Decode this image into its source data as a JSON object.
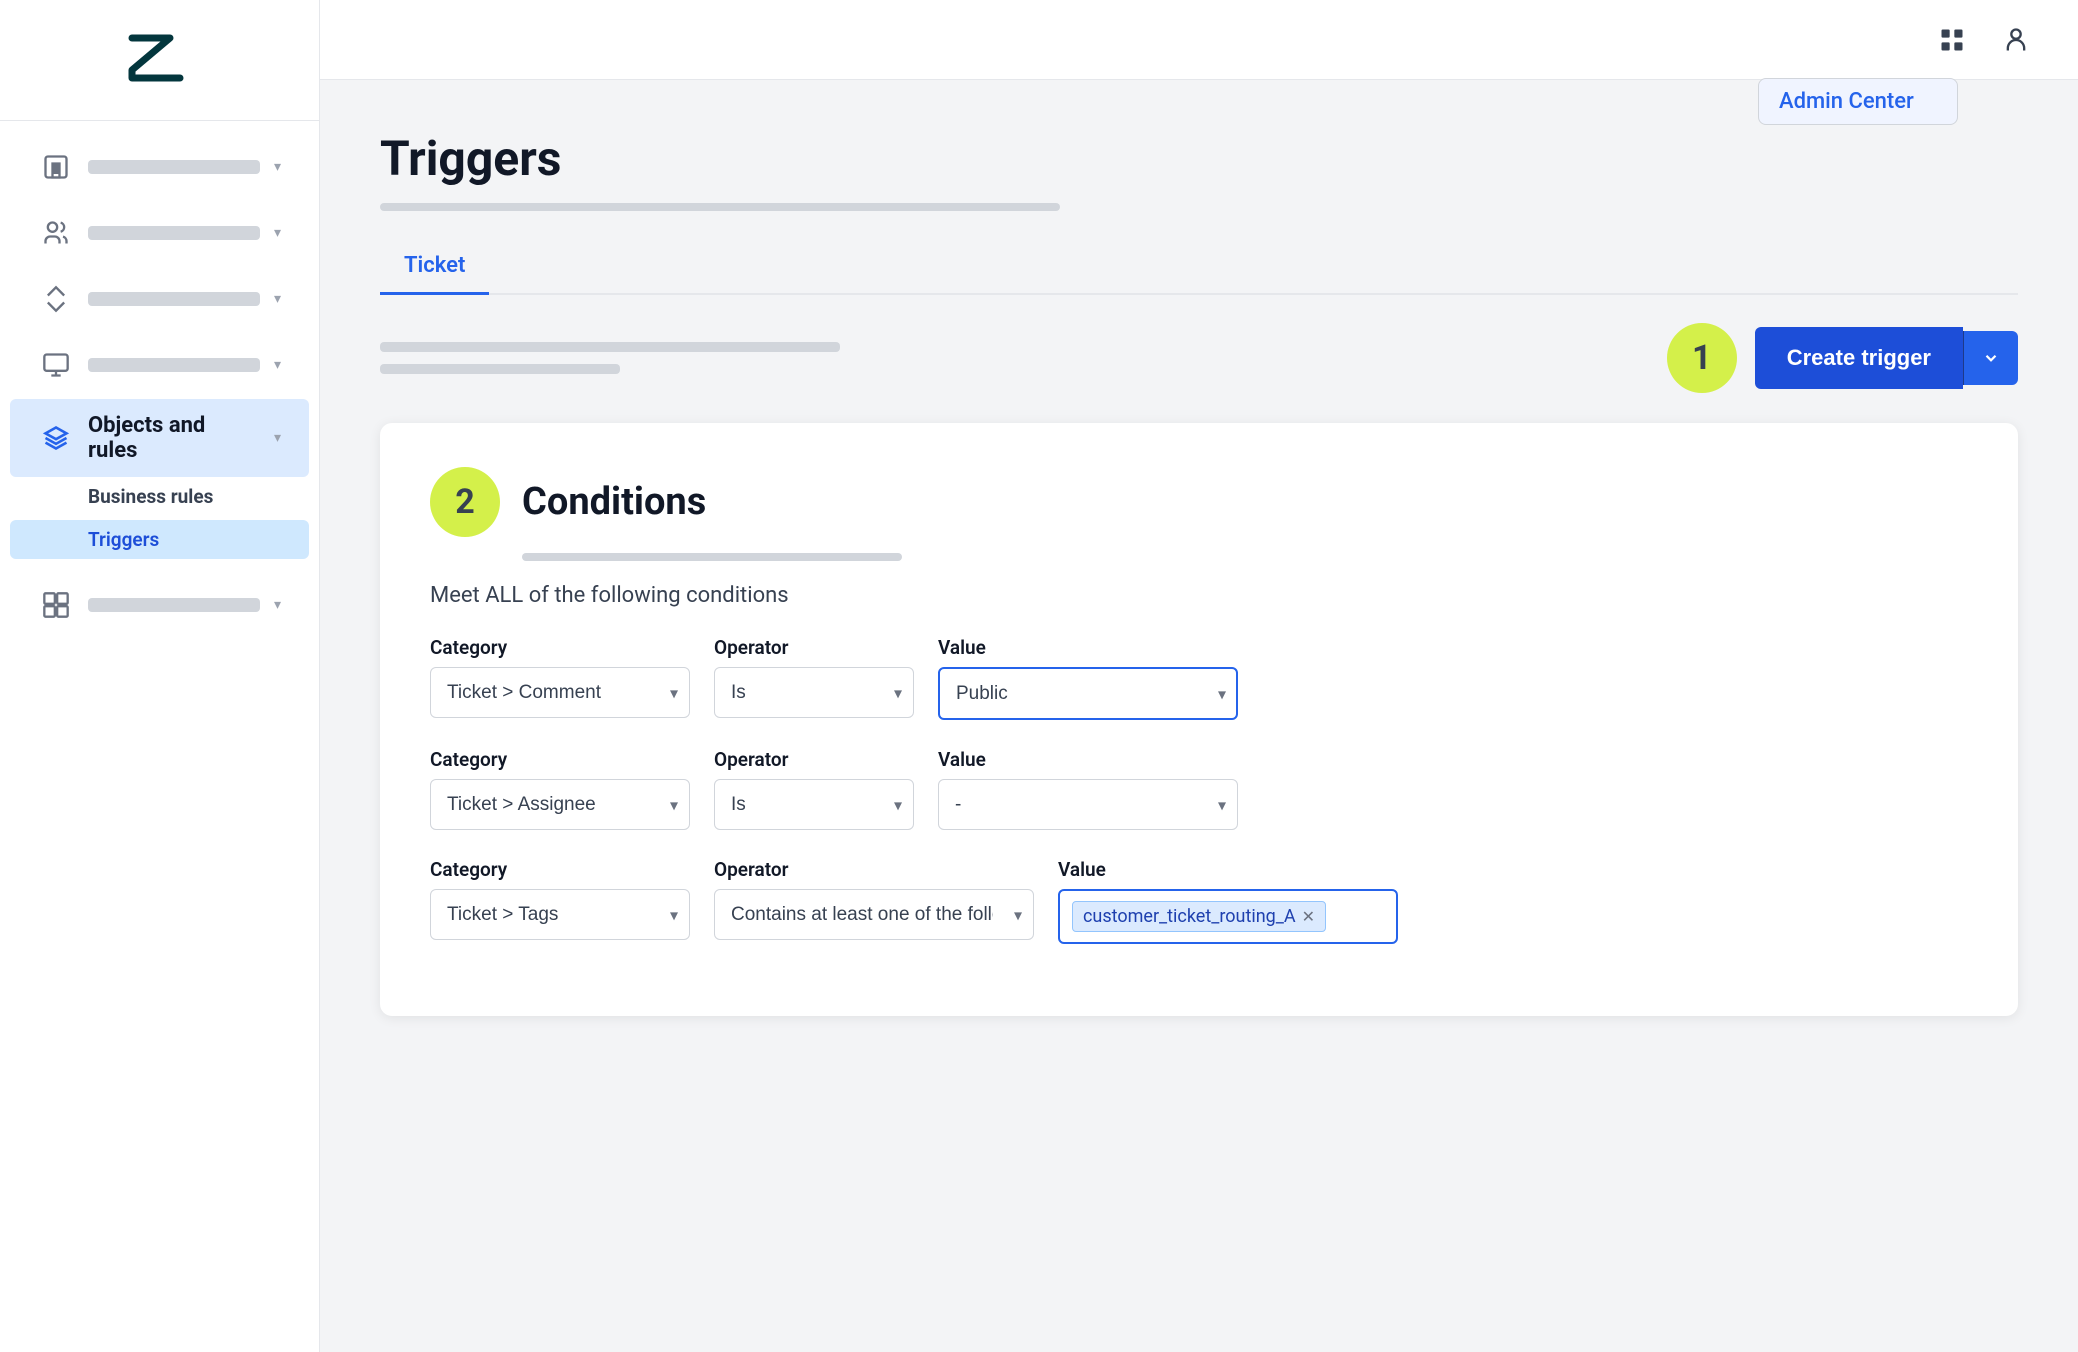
{
  "sidebar": {
    "nav_items": [
      {
        "id": "building",
        "icon": "building",
        "active": false
      },
      {
        "id": "people",
        "icon": "people",
        "active": false
      },
      {
        "id": "routing",
        "icon": "routing",
        "active": false
      },
      {
        "id": "workspaces",
        "icon": "workspaces",
        "active": false
      },
      {
        "id": "objects-and-rules",
        "icon": "objects-and-rules",
        "label": "Objects and rules",
        "active": true
      },
      {
        "id": "apps",
        "icon": "apps",
        "active": false
      }
    ],
    "sub_nav": {
      "group_label": "Business rules",
      "items": [
        {
          "id": "triggers",
          "label": "Triggers",
          "selected": true
        }
      ]
    }
  },
  "topbar": {
    "admin_center_label": "Admin Center"
  },
  "page": {
    "title": "Triggers",
    "tab_active": "Ticket",
    "tabs": [
      "Ticket"
    ],
    "create_trigger_label": "Create trigger"
  },
  "step1": {
    "badge": "1"
  },
  "step2": {
    "badge": "2"
  },
  "conditions": {
    "section_title": "Conditions",
    "meet_all_text": "Meet ALL of the following conditions",
    "rows": [
      {
        "category_label": "Category",
        "category_value": "Ticket > Comment",
        "operator_label": "Operator",
        "operator_value": "Is",
        "value_label": "Value",
        "value_value": "Public"
      },
      {
        "category_label": "Category",
        "category_value": "Ticket > Assignee",
        "operator_label": "Operator",
        "operator_value": "Is",
        "value_label": "Value",
        "value_value": "-"
      },
      {
        "category_label": "Category",
        "category_value": "Ticket > Tags",
        "operator_label": "Operator",
        "operator_value": "Contains at least one of the following",
        "value_label": "Value",
        "value_tag": "customer_ticket_routing_A"
      }
    ]
  }
}
